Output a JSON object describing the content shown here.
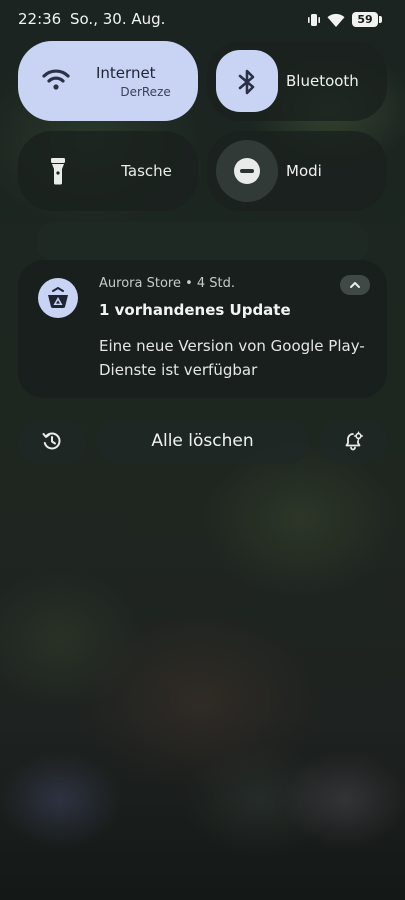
{
  "status_bar": {
    "time": "22:36",
    "date": "So., 30. Aug.",
    "battery": "59",
    "icons": [
      "vibrate-icon",
      "wifi-icon",
      "battery-icon"
    ]
  },
  "quick_settings": {
    "internet": {
      "title": "Internet",
      "subtitle_parts": [
        "er",
        "DerReze"
      ],
      "icon": "wifi-icon",
      "active": true
    },
    "bluetooth": {
      "title": "Bluetooth",
      "icon": "bluetooth-icon",
      "active": true
    },
    "torch": {
      "title_parts": [
        "e",
        "Tasche"
      ],
      "icon": "flashlight-icon",
      "active": false
    },
    "modes": {
      "title": "Modi",
      "icon": "do-not-disturb-icon",
      "active": false
    }
  },
  "notification": {
    "app_icon": "aurora-store-icon",
    "header": "Aurora Store • 4 Std.",
    "title": "1 vorhandenes Update",
    "body": "Eine neue Version von Google Play-Dienste ist verfügbar"
  },
  "actions": {
    "history_icon": "history-icon",
    "clear_all_label": "Alle löschen",
    "settings_icon": "notification-settings-icon"
  },
  "colors": {
    "accent_tile": "#c9d4f5",
    "card": "#181e1c",
    "text": "#e9eceb"
  }
}
